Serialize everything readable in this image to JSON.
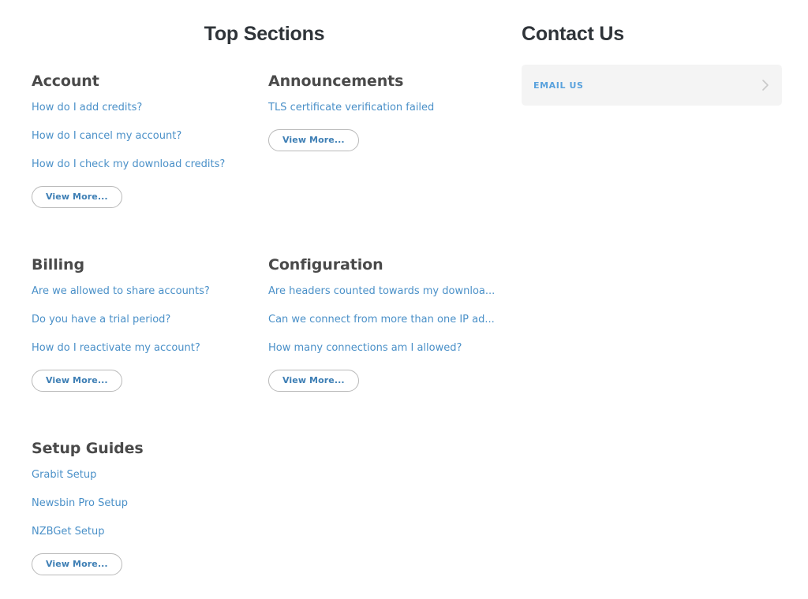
{
  "page": {
    "background": "#ffffff",
    "link_color": "#4a90c8",
    "heading_color": "#2f3439",
    "section_title_color": "#4a4a4a",
    "card_background": "#f4f4f4"
  },
  "main": {
    "heading": "Top Sections",
    "view_more_label": "View More...",
    "sections": [
      {
        "title": "Account",
        "links": [
          "How do I add credits?",
          "How do I cancel my account?",
          "How do I check my download credits?"
        ],
        "view_more": "View More..."
      },
      {
        "title": "Announcements",
        "links": [
          "TLS certificate verification failed"
        ],
        "view_more": "View More..."
      },
      {
        "title": "Billing",
        "links": [
          "Are we allowed to share accounts?",
          "Do you have a trial period?",
          "How do I reactivate my account?"
        ],
        "view_more": "View More..."
      },
      {
        "title": "Configuration",
        "links": [
          "Are headers counted towards my downloa...",
          "Can we connect from more than one IP ad...",
          "How many connections am I allowed?"
        ],
        "view_more": "View More..."
      },
      {
        "title": "Setup Guides",
        "links": [
          "Grabit Setup",
          "Newsbin Pro Setup",
          "NZBGet Setup"
        ],
        "view_more": "View More..."
      }
    ]
  },
  "contact": {
    "heading": "Contact Us",
    "items": [
      {
        "label": "EMAIL US",
        "icon": "chevron-right-icon"
      }
    ]
  }
}
